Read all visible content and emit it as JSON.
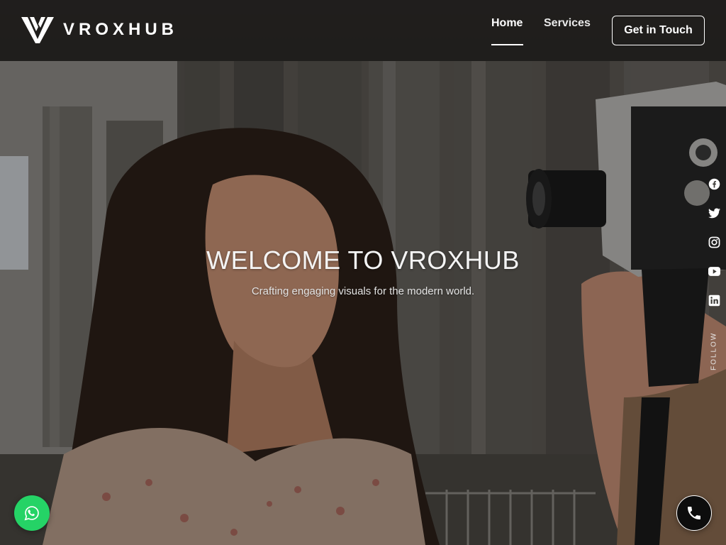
{
  "brand": {
    "name": "VROXHUB",
    "logo_icon": "v-monogram-logo-icon"
  },
  "nav": {
    "items": [
      {
        "label": "Home",
        "active": true
      },
      {
        "label": "Services",
        "active": false
      }
    ],
    "cta_label": "Get in Touch"
  },
  "hero": {
    "title": "WELCOME TO VROXHUB",
    "subtitle": "Crafting engaging visuals for the modern world.",
    "background_image": "woman-with-vintage-camera-photo"
  },
  "social": {
    "follow_label": "FOLLOW",
    "items": [
      {
        "name": "facebook",
        "icon": "facebook-icon"
      },
      {
        "name": "twitter",
        "icon": "twitter-icon"
      },
      {
        "name": "instagram",
        "icon": "instagram-icon"
      },
      {
        "name": "youtube",
        "icon": "youtube-icon"
      },
      {
        "name": "linkedin",
        "icon": "linkedin-icon"
      }
    ]
  },
  "floating": {
    "whatsapp_icon": "whatsapp-icon",
    "call_icon": "phone-icon"
  },
  "colors": {
    "header_bg": "#161514",
    "accent_white": "#ffffff",
    "whatsapp_green": "#25d366",
    "call_black": "#0d0d0d"
  }
}
